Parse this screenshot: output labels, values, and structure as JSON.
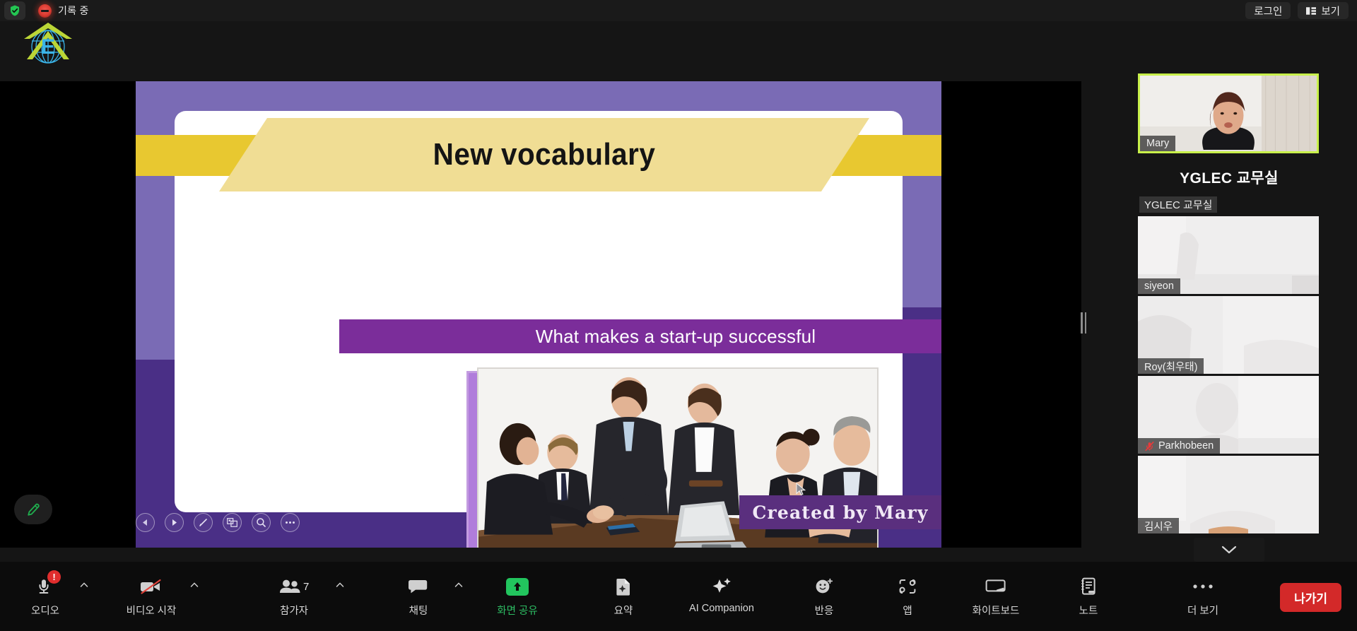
{
  "topbar": {
    "shield_icon": "shield-check-icon",
    "recording_icon": "recording-dot-icon",
    "recording_label": "기록 중",
    "login_label": "로그인",
    "view_label": "보기",
    "view_icon": "layout-view-icon"
  },
  "logo": {
    "name": "yglec-logo",
    "letter": "E"
  },
  "slide": {
    "title": "New vocabulary",
    "subtitle": "What makes a start-up successful",
    "footer": "Created by Mary",
    "photo_alt": "business-team-meeting-photo",
    "nav": [
      {
        "name": "prev-slide-button",
        "icon": "triangle-left-icon"
      },
      {
        "name": "next-slide-button",
        "icon": "triangle-right-icon"
      },
      {
        "name": "annotate-pen-button",
        "icon": "pen-icon"
      },
      {
        "name": "slide-thumbnails-button",
        "icon": "grid-layout-icon"
      },
      {
        "name": "zoom-button",
        "icon": "magnifier-icon"
      },
      {
        "name": "more-options-button",
        "icon": "ellipsis-icon"
      }
    ],
    "annotate_label": "annotate-pen-icon",
    "colors": {
      "bg_light_purple": "#7a6bb5",
      "bg_dark_purple": "#4a2f86",
      "ribbon_light": "#f0dd94",
      "ribbon_dark": "#e8c830",
      "subtitle_bar": "#7b2d9a",
      "footer_bar": "#5a2f7e",
      "photo_frame": "#b07ddb"
    }
  },
  "panel": {
    "title": "YGLEC 교무실",
    "subtitle": "YGLEC 교무실",
    "scroll_icon": "chevron-down-icon",
    "active_border_color": "#c8f04a",
    "tiles": [
      {
        "name": "Mary",
        "active": true,
        "muted": false
      },
      {
        "name": "siyeon",
        "active": false,
        "muted": false
      },
      {
        "name": "Roy(최우태)",
        "active": false,
        "muted": false
      },
      {
        "name": "Parkhobeen",
        "active": false,
        "muted": true
      },
      {
        "name": "김시우",
        "active": false,
        "muted": false
      }
    ]
  },
  "toolbar": {
    "items": [
      {
        "label": "오디오",
        "icon": "microphone-alert-icon",
        "caret": true,
        "badge": "!",
        "green": false
      },
      {
        "label": "비디오 시작",
        "icon": "video-off-icon",
        "caret": true,
        "badge": "",
        "green": false
      },
      {
        "label": "참가자",
        "icon": "participants-icon",
        "caret": true,
        "badge": "",
        "count": "7",
        "green": false
      },
      {
        "label": "채팅",
        "icon": "chat-bubble-icon",
        "caret": true,
        "badge": "",
        "green": false
      },
      {
        "label": "화면 공유",
        "icon": "share-screen-icon",
        "caret": false,
        "badge": "",
        "green": true
      },
      {
        "label": "요약",
        "icon": "summary-doc-icon",
        "caret": false,
        "badge": "",
        "green": false
      },
      {
        "label": "AI Companion",
        "icon": "ai-sparkle-icon",
        "caret": false,
        "badge": "",
        "green": false
      },
      {
        "label": "반응",
        "icon": "reactions-smiley-icon",
        "caret": false,
        "badge": "",
        "green": false
      },
      {
        "label": "앱",
        "icon": "apps-icon",
        "caret": false,
        "badge": "",
        "green": false
      },
      {
        "label": "화이트보드",
        "icon": "whiteboard-icon",
        "caret": false,
        "badge": "",
        "green": false
      },
      {
        "label": "노트",
        "icon": "notes-icon",
        "caret": false,
        "badge": "",
        "green": false
      },
      {
        "label": "더 보기",
        "icon": "ellipsis-icon",
        "caret": false,
        "badge": "",
        "green": false
      }
    ],
    "leave_label": "나가기",
    "leave_color": "#d32929"
  }
}
